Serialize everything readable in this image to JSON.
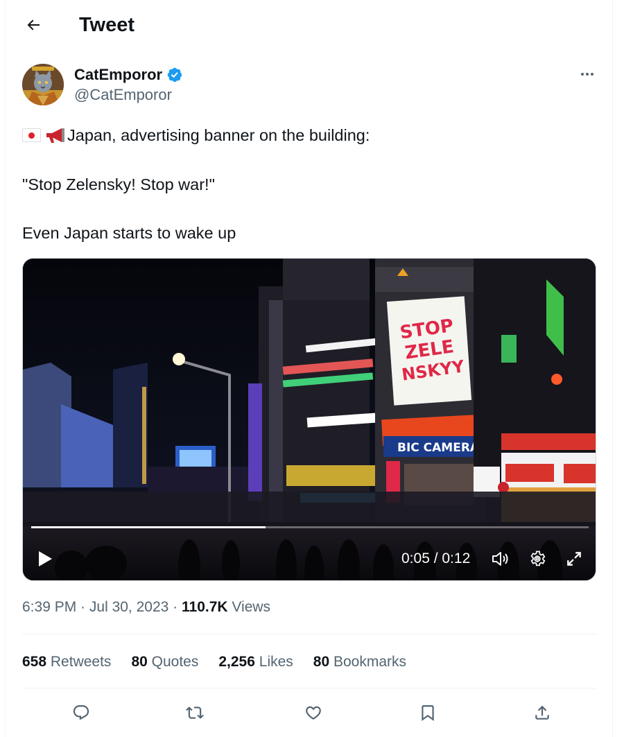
{
  "header": {
    "title": "Tweet",
    "back_icon": "arrow-left-icon"
  },
  "author": {
    "name": "CatEmporor",
    "handle": "@CatEmporor",
    "verified": true,
    "verified_color": "#1d9bf0"
  },
  "tweet": {
    "emoji": [
      "japan-flag-icon",
      "megaphone-icon"
    ],
    "line1": "Japan, advertising banner on the building:",
    "line2": "\"Stop Zelensky! Stop war!\"",
    "line3": "Even Japan starts to wake up"
  },
  "video": {
    "billboard_text": [
      "STOP",
      "ZELE",
      "NSKYY"
    ],
    "store_sign": "BIC CAMERA",
    "time": "0:05 / 0:12",
    "progress": 0.42,
    "controls": [
      "play-icon",
      "volume-icon",
      "settings-icon",
      "fullscreen-icon"
    ]
  },
  "meta": {
    "time": "6:39 PM",
    "sep1": " · ",
    "date": "Jul 30, 2023",
    "sep2": " · ",
    "views_count": "110.7K",
    "views_label": " Views"
  },
  "stats": [
    {
      "count": "658",
      "label": "Retweets"
    },
    {
      "count": "80",
      "label": "Quotes"
    },
    {
      "count": "2,256",
      "label": "Likes"
    },
    {
      "count": "80",
      "label": "Bookmarks"
    }
  ],
  "actions": [
    "reply-icon",
    "retweet-icon",
    "like-icon",
    "bookmark-icon",
    "share-icon"
  ],
  "colors": {
    "text": "#0f1419",
    "secondary": "#536471",
    "accent": "#1d9bf0",
    "border": "#eff3f4"
  }
}
